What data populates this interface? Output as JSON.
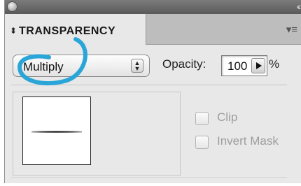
{
  "panel": {
    "tab_label": "TRANSPARENCY",
    "tab_icon": "up-down-arrows-icon",
    "collapse_icon": "double-chevron-icon",
    "menu_icon": "panel-menu-icon"
  },
  "blend_mode": {
    "selected": "Multiply",
    "icon": "stepper-arrows-icon"
  },
  "opacity": {
    "label": "Opacity:",
    "value": "100",
    "unit": "%"
  },
  "options": {
    "clip_label": "Clip",
    "clip_checked": false,
    "invert_mask_label": "Invert Mask",
    "invert_mask_checked": false
  },
  "colors": {
    "annotation": "#2aa5d8",
    "panel_bg": "#e8e8e8",
    "disabled_text": "#9d9d9d"
  }
}
